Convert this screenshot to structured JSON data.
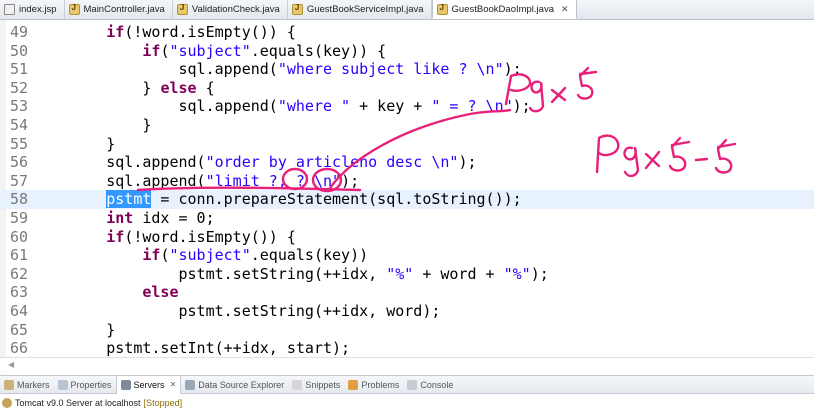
{
  "tabs": [
    {
      "label": "index.jsp",
      "icon": "jsp-file-icon",
      "active": false
    },
    {
      "label": "MainController.java",
      "icon": "java-file-icon",
      "active": false
    },
    {
      "label": "ValidationCheck.java",
      "icon": "java-file-icon",
      "active": false
    },
    {
      "label": "GuestBookServiceImpl.java",
      "icon": "java-file-icon",
      "active": false
    },
    {
      "label": "GuestBookDaoImpl.java",
      "icon": "java-file-icon",
      "active": true
    }
  ],
  "code": {
    "current_line": "58",
    "lines": [
      {
        "n": "49",
        "t": [
          [
            "sp",
            "        "
          ],
          [
            "kw",
            "if"
          ],
          [
            "v",
            "(!word.isEmpty()) {"
          ]
        ]
      },
      {
        "n": "50",
        "t": [
          [
            "sp",
            "            "
          ],
          [
            "kw",
            "if"
          ],
          [
            "v",
            "("
          ],
          [
            "s",
            "\"subject\""
          ],
          [
            "v",
            ".equals(key)) {"
          ]
        ]
      },
      {
        "n": "51",
        "t": [
          [
            "sp",
            "                "
          ],
          [
            "v",
            "sql.append("
          ],
          [
            "s",
            "\"where subject like ? \\n\""
          ],
          [
            "v",
            ");"
          ]
        ]
      },
      {
        "n": "52",
        "t": [
          [
            "sp",
            "            "
          ],
          [
            "v",
            "} "
          ],
          [
            "kw",
            "else"
          ],
          [
            "v",
            " {"
          ]
        ]
      },
      {
        "n": "53",
        "t": [
          [
            "sp",
            "                "
          ],
          [
            "v",
            "sql.append("
          ],
          [
            "s",
            "\"where \""
          ],
          [
            "v",
            " + key + "
          ],
          [
            "s",
            "\" = ? \\n\""
          ],
          [
            "v",
            ");"
          ]
        ]
      },
      {
        "n": "54",
        "t": [
          [
            "sp",
            "            "
          ],
          [
            "v",
            "}"
          ]
        ]
      },
      {
        "n": "55",
        "t": [
          [
            "sp",
            "        "
          ],
          [
            "v",
            "}"
          ]
        ]
      },
      {
        "n": "56",
        "t": [
          [
            "sp",
            "        "
          ],
          [
            "v",
            "sql.append("
          ],
          [
            "s",
            "\"order by articleno desc \\n\""
          ],
          [
            "v",
            ");"
          ]
        ]
      },
      {
        "n": "57",
        "t": [
          [
            "sp",
            "        "
          ],
          [
            "v",
            "sql.append("
          ],
          [
            "s",
            "\"limit ?, ? \\n\""
          ],
          [
            "v",
            ");"
          ]
        ]
      },
      {
        "n": "58",
        "t": [
          [
            "sp",
            "        "
          ],
          [
            "sel",
            "pstmt"
          ],
          [
            "v",
            " = conn.prepareStatement(sql.toString());"
          ]
        ]
      },
      {
        "n": "59",
        "t": [
          [
            "sp",
            "        "
          ],
          [
            "kw",
            "int"
          ],
          [
            "v",
            " idx = 0;"
          ]
        ]
      },
      {
        "n": "60",
        "t": [
          [
            "sp",
            "        "
          ],
          [
            "kw",
            "if"
          ],
          [
            "v",
            "(!word.isEmpty()) {"
          ]
        ]
      },
      {
        "n": "61",
        "t": [
          [
            "sp",
            "            "
          ],
          [
            "kw",
            "if"
          ],
          [
            "v",
            "("
          ],
          [
            "s",
            "\"subject\""
          ],
          [
            "v",
            ".equals(key))"
          ]
        ]
      },
      {
        "n": "62",
        "t": [
          [
            "sp",
            "                "
          ],
          [
            "v",
            "pstmt.setString(++idx, "
          ],
          [
            "s",
            "\"%\""
          ],
          [
            "v",
            " + word + "
          ],
          [
            "s",
            "\"%\""
          ],
          [
            "v",
            ");"
          ]
        ]
      },
      {
        "n": "63",
        "t": [
          [
            "sp",
            "            "
          ],
          [
            "kw",
            "else"
          ]
        ]
      },
      {
        "n": "64",
        "t": [
          [
            "sp",
            "                "
          ],
          [
            "v",
            "pstmt.setString(++idx, word);"
          ]
        ]
      },
      {
        "n": "65",
        "t": [
          [
            "sp",
            "        "
          ],
          [
            "v",
            "}"
          ]
        ]
      },
      {
        "n": "66",
        "t": [
          [
            "sp",
            "        "
          ],
          [
            "v",
            "pstmt.setInt(++idx, start);"
          ]
        ]
      }
    ]
  },
  "handwriting": {
    "note1": "Pg * 5",
    "note2": "Pg * 5 - 5",
    "ink_color": "#e8207a"
  },
  "views": [
    {
      "label": "Markers",
      "icon": "markers-icon",
      "active": false
    },
    {
      "label": "Properties",
      "icon": "properties-icon",
      "active": false
    },
    {
      "label": "Servers",
      "icon": "servers-icon",
      "active": true
    },
    {
      "label": "Data Source Explorer",
      "icon": "data-source-icon",
      "active": false
    },
    {
      "label": "Snippets",
      "icon": "snippets-icon",
      "active": false
    },
    {
      "label": "Problems",
      "icon": "problems-icon",
      "active": false
    },
    {
      "label": "Console",
      "icon": "console-icon",
      "active": false
    }
  ],
  "server": {
    "name": "Tomcat v9.0 Server at localhost",
    "status": "[Stopped]"
  },
  "colors": {
    "keyword": "#7f0055",
    "string": "#2a00ff",
    "selection": "#3399ff",
    "current_line": "#e8f2fe"
  }
}
